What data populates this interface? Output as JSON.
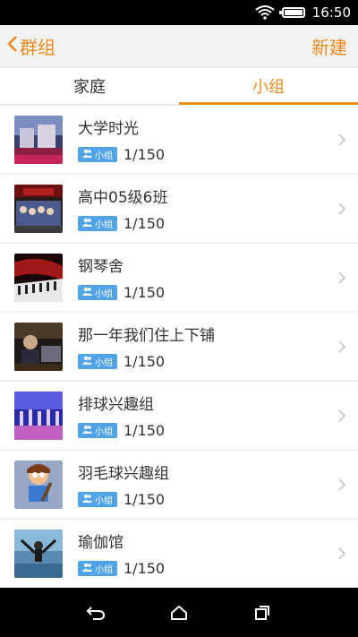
{
  "status_bar": {
    "time": "16:50",
    "wifi_icon": "wifi-icon",
    "battery_icon": "battery-icon"
  },
  "navbar": {
    "back_label": "群组",
    "new_label": "新建",
    "accent": "#f08a1c"
  },
  "tabs": [
    {
      "label": "家庭",
      "active": false
    },
    {
      "label": "小组",
      "active": true
    }
  ],
  "groups": [
    {
      "name": "大学时光",
      "badge": "小组",
      "count": "1/150"
    },
    {
      "name": "高中05级6班",
      "badge": "小组",
      "count": "1/150"
    },
    {
      "name": "钢琴舍",
      "badge": "小组",
      "count": "1/150"
    },
    {
      "name": "那一年我们住上下铺",
      "badge": "小组",
      "count": "1/150"
    },
    {
      "name": "排球兴趣组",
      "badge": "小组",
      "count": "1/150"
    },
    {
      "name": "羽毛球兴趣组",
      "badge": "小组",
      "count": "1/150"
    },
    {
      "name": "瑜伽馆",
      "badge": "小组",
      "count": "1/150"
    }
  ],
  "system_nav": {
    "back_icon": "back-icon",
    "home_icon": "home-icon",
    "recents_icon": "recents-icon"
  }
}
